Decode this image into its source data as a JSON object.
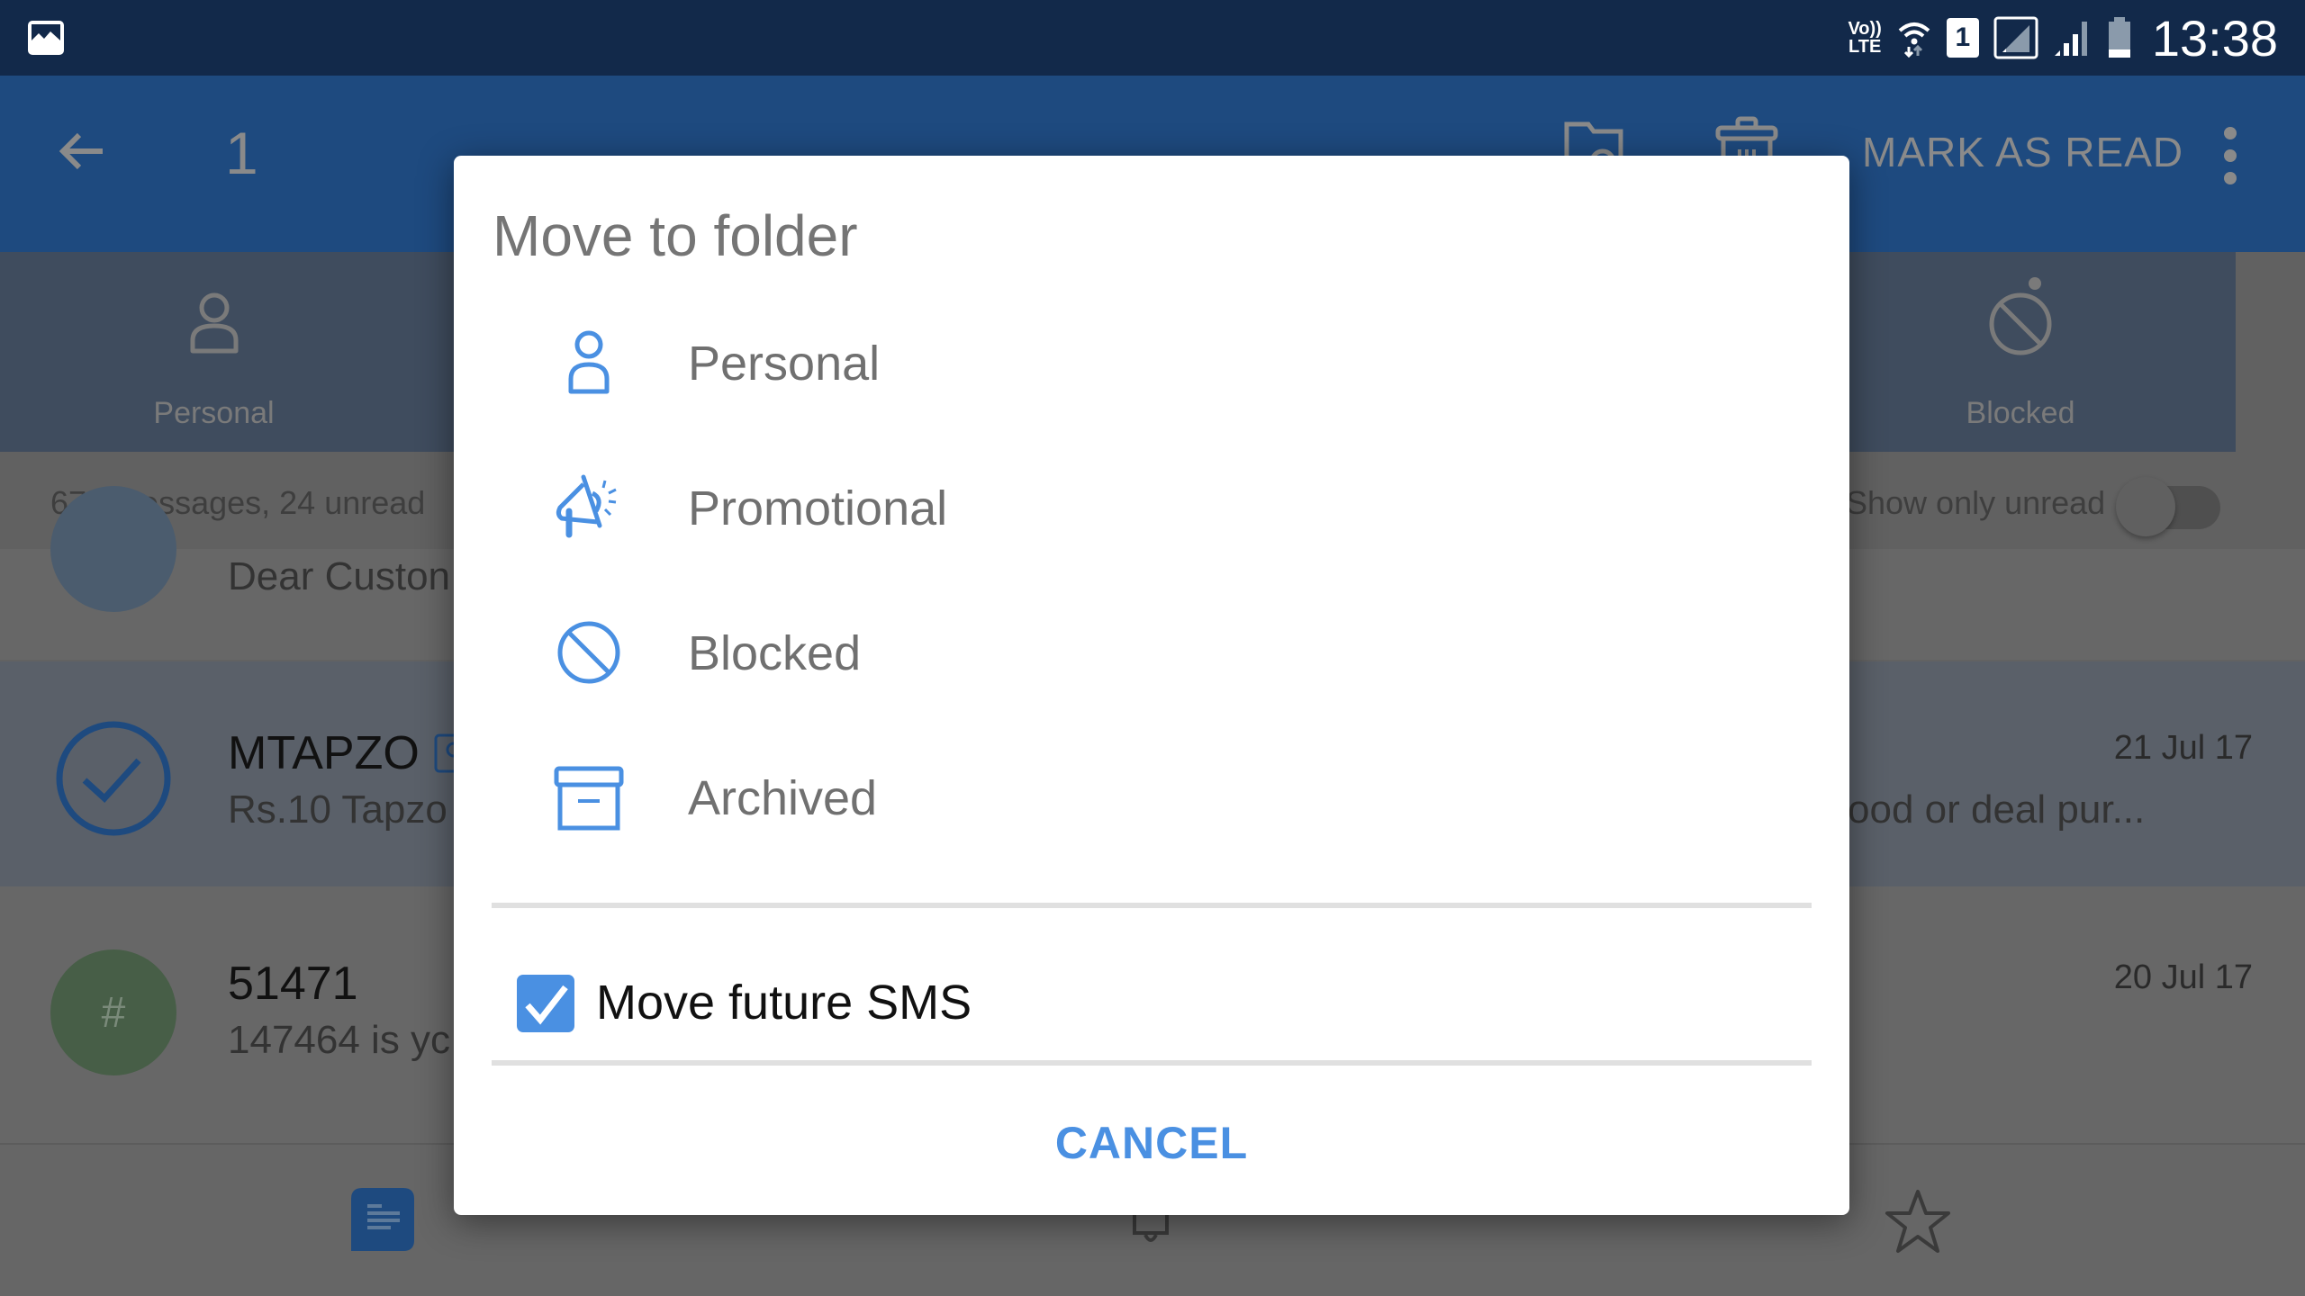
{
  "status_bar": {
    "time": "13:38",
    "network_label_top": "Vo))",
    "network_label_bottom": "LTE",
    "sim_slot": "1",
    "icons": [
      "gallery-notification-icon",
      "volte-icon",
      "wifi-icon",
      "sim-1-icon",
      "signal-sim2-icon",
      "signal-icon",
      "battery-icon"
    ]
  },
  "app_bar": {
    "selected_count": "1",
    "mark_as_read_label": "MARK AS READ",
    "icons": [
      "back-arrow-icon",
      "move-to-folder-icon",
      "delete-icon",
      "overflow-menu-icon"
    ]
  },
  "tabs": [
    {
      "label": "Personal",
      "icon": "person-icon"
    },
    {
      "label": "Blocked",
      "icon": "blocked-icon",
      "has_dot": true
    }
  ],
  "summary": {
    "message_count_text": "675 messages, 24 unread",
    "show_only_unread_label": "Show only unread",
    "show_only_unread_on": false
  },
  "messages": [
    {
      "name": "",
      "preview": "Dear Custon",
      "avatar_letter": "",
      "date": ""
    },
    {
      "name": "MTAPZO",
      "preview": "Rs.10 Tapzo",
      "preview_tail": "ood or deal pur...",
      "date": "21 Jul 17",
      "selected": true
    },
    {
      "name": "51471",
      "preview": "147464 is yc",
      "avatar_letter": "#",
      "date": "20 Jul 17"
    }
  ],
  "bottom_nav": {
    "icons": [
      "messages-icon",
      "notifications-bell-icon",
      "starred-icon"
    ]
  },
  "dialog": {
    "title": "Move to folder",
    "folders": [
      {
        "label": "Personal",
        "icon": "person-icon"
      },
      {
        "label": "Promotional",
        "icon": "megaphone-icon"
      },
      {
        "label": "Blocked",
        "icon": "blocked-icon"
      },
      {
        "label": "Archived",
        "icon": "archive-box-icon"
      }
    ],
    "move_future_sms_label": "Move future SMS",
    "move_future_sms_checked": true,
    "cancel_label": "CANCEL"
  },
  "colors": {
    "accent": "#4a90e2",
    "status_bar": "#12294a",
    "app_bar": "#1e4a7f"
  }
}
